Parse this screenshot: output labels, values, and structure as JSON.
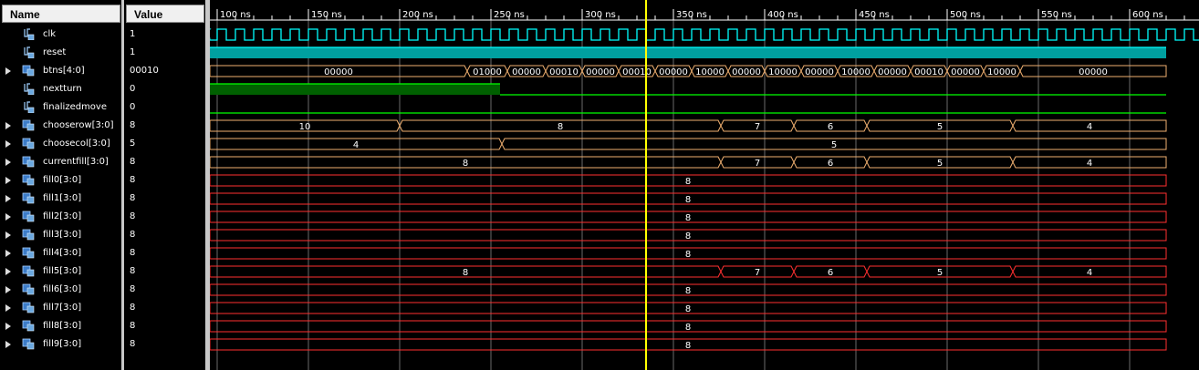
{
  "headers": {
    "name": "Name",
    "value": "Value"
  },
  "timeline": {
    "ticks": [
      "100 ns",
      "150 ns",
      "200 ns",
      "250 ns",
      "300 ns",
      "350 ns",
      "400 ns",
      "450 ns",
      "500 ns",
      "550 ns",
      "600 ns"
    ],
    "cursor_ns": 335
  },
  "colors": {
    "green": "#00ff00",
    "bus": "#f0b070",
    "red": "#ff3030",
    "grid": "#ffffff",
    "cursor": "#ffff00",
    "teal": "#00a0a0"
  },
  "signals": [
    {
      "name": "clk",
      "value": "1",
      "type": "bit",
      "icon": "bit-signal-icon"
    },
    {
      "name": "reset",
      "value": "1",
      "type": "bit",
      "icon": "bit-signal-icon"
    },
    {
      "name": "btns[4:0]",
      "value": "00010",
      "type": "bus",
      "icon": "bus-signal-icon"
    },
    {
      "name": "nextturn",
      "value": "0",
      "type": "bit",
      "icon": "bit-signal-icon"
    },
    {
      "name": "finalizedmove",
      "value": "0",
      "type": "bit",
      "icon": "bit-signal-icon"
    },
    {
      "name": "chooserow[3:0]",
      "value": "8",
      "type": "bus",
      "icon": "bus-signal-icon"
    },
    {
      "name": "choosecol[3:0]",
      "value": "5",
      "type": "bus",
      "icon": "bus-signal-icon"
    },
    {
      "name": "currentfill[3:0]",
      "value": "8",
      "type": "bus",
      "icon": "bus-signal-icon"
    },
    {
      "name": "fill0[3:0]",
      "value": "8",
      "type": "bus",
      "icon": "bus-signal-icon"
    },
    {
      "name": "fill1[3:0]",
      "value": "8",
      "type": "bus",
      "icon": "bus-signal-icon"
    },
    {
      "name": "fill2[3:0]",
      "value": "8",
      "type": "bus",
      "icon": "bus-signal-icon"
    },
    {
      "name": "fill3[3:0]",
      "value": "8",
      "type": "bus",
      "icon": "bus-signal-icon"
    },
    {
      "name": "fill4[3:0]",
      "value": "8",
      "type": "bus",
      "icon": "bus-signal-icon"
    },
    {
      "name": "fill5[3:0]",
      "value": "8",
      "type": "bus",
      "icon": "bus-signal-icon"
    },
    {
      "name": "fill6[3:0]",
      "value": "8",
      "type": "bus",
      "icon": "bus-signal-icon"
    },
    {
      "name": "fill7[3:0]",
      "value": "8",
      "type": "bus",
      "icon": "bus-signal-icon"
    },
    {
      "name": "fill8[3:0]",
      "value": "8",
      "type": "bus",
      "icon": "bus-signal-icon"
    },
    {
      "name": "fill9[3:0]",
      "value": "8",
      "type": "bus",
      "icon": "bus-signal-icon"
    }
  ],
  "waves": {
    "clk": {
      "kind": "clock",
      "period_ns": 10
    },
    "reset": {
      "kind": "bit",
      "segments": [
        [
          80,
          200,
          1
        ],
        [
          200,
          620,
          1
        ]
      ]
    },
    "btns": {
      "kind": "bus",
      "segments": [
        [
          80,
          237,
          "00000"
        ],
        [
          237,
          259,
          "01000"
        ],
        [
          259,
          280,
          "00000"
        ],
        [
          280,
          300,
          "00010"
        ],
        [
          300,
          320,
          "00000"
        ],
        [
          320,
          340,
          "00010"
        ],
        [
          340,
          360,
          "00000"
        ],
        [
          360,
          380,
          "10000"
        ],
        [
          380,
          400,
          "00000"
        ],
        [
          400,
          420,
          "10000"
        ],
        [
          420,
          440,
          "00000"
        ],
        [
          440,
          460,
          "10000"
        ],
        [
          460,
          480,
          "00000"
        ],
        [
          480,
          500,
          "00010"
        ],
        [
          500,
          520,
          "00000"
        ],
        [
          520,
          540,
          "10000"
        ],
        [
          540,
          620,
          "00000"
        ]
      ]
    },
    "nextturn": {
      "kind": "bit",
      "segments": [
        [
          80,
          255,
          1
        ],
        [
          255,
          620,
          0
        ]
      ]
    },
    "finalizedmove": {
      "kind": "bit",
      "segments": [
        [
          80,
          620,
          0
        ]
      ]
    },
    "chooserow": {
      "kind": "bus",
      "segments": [
        [
          80,
          200,
          "10"
        ],
        [
          200,
          376,
          "8"
        ],
        [
          376,
          416,
          "7"
        ],
        [
          416,
          456,
          "6"
        ],
        [
          456,
          536,
          "5"
        ],
        [
          536,
          620,
          "4"
        ]
      ]
    },
    "choosecol": {
      "kind": "bus",
      "segments": [
        [
          80,
          256,
          "4"
        ],
        [
          256,
          620,
          "5"
        ]
      ]
    },
    "currentfill": {
      "kind": "bus",
      "segments": [
        [
          80,
          376,
          "8"
        ],
        [
          376,
          416,
          "7"
        ],
        [
          416,
          456,
          "6"
        ],
        [
          456,
          536,
          "5"
        ],
        [
          536,
          620,
          "4"
        ]
      ]
    },
    "fill0": {
      "kind": "bus",
      "color": "red",
      "segments": [
        [
          80,
          620,
          "8"
        ]
      ]
    },
    "fill1": {
      "kind": "bus",
      "color": "red",
      "segments": [
        [
          80,
          620,
          "8"
        ]
      ]
    },
    "fill2": {
      "kind": "bus",
      "color": "red",
      "segments": [
        [
          80,
          620,
          "8"
        ]
      ]
    },
    "fill3": {
      "kind": "bus",
      "color": "red",
      "segments": [
        [
          80,
          620,
          "8"
        ]
      ]
    },
    "fill4": {
      "kind": "bus",
      "color": "red",
      "segments": [
        [
          80,
          620,
          "8"
        ]
      ]
    },
    "fill5": {
      "kind": "bus",
      "color": "red",
      "segments": [
        [
          80,
          376,
          "8"
        ],
        [
          376,
          416,
          "7"
        ],
        [
          416,
          456,
          "6"
        ],
        [
          456,
          536,
          "5"
        ],
        [
          536,
          620,
          "4"
        ]
      ]
    },
    "fill6": {
      "kind": "bus",
      "color": "red",
      "segments": [
        [
          80,
          620,
          "8"
        ]
      ]
    },
    "fill7": {
      "kind": "bus",
      "color": "red",
      "segments": [
        [
          80,
          620,
          "8"
        ]
      ]
    },
    "fill8": {
      "kind": "bus",
      "color": "red",
      "segments": [
        [
          80,
          620,
          "8"
        ]
      ]
    },
    "fill9": {
      "kind": "bus",
      "color": "red",
      "segments": [
        [
          80,
          620,
          "8"
        ]
      ]
    }
  }
}
